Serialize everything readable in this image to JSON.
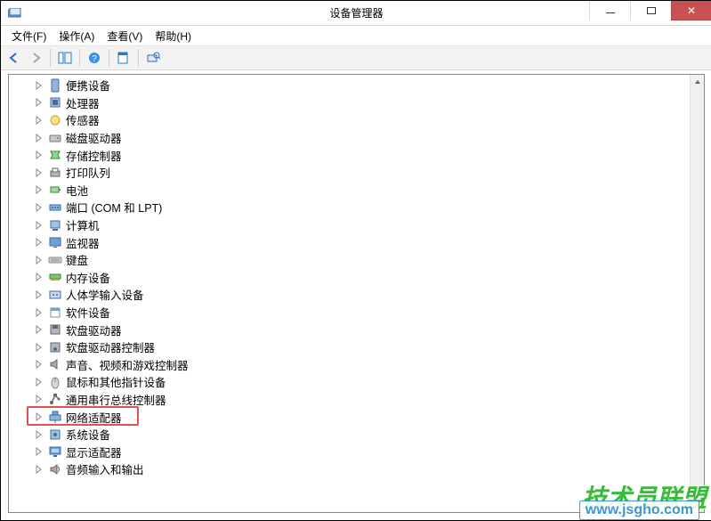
{
  "window": {
    "title": "设备管理器"
  },
  "menu": {
    "file": "文件(F)",
    "action": "操作(A)",
    "view": "查看(V)",
    "help": "帮助(H)"
  },
  "tree": {
    "items": [
      {
        "label": "便携设备",
        "icon": "portable"
      },
      {
        "label": "处理器",
        "icon": "cpu"
      },
      {
        "label": "传感器",
        "icon": "sensor"
      },
      {
        "label": "磁盘驱动器",
        "icon": "disk"
      },
      {
        "label": "存储控制器",
        "icon": "storage"
      },
      {
        "label": "打印队列",
        "icon": "printer"
      },
      {
        "label": "电池",
        "icon": "battery"
      },
      {
        "label": "端口 (COM 和 LPT)",
        "icon": "port"
      },
      {
        "label": "计算机",
        "icon": "computer"
      },
      {
        "label": "监视器",
        "icon": "monitor"
      },
      {
        "label": "键盘",
        "icon": "keyboard"
      },
      {
        "label": "内存设备",
        "icon": "memory"
      },
      {
        "label": "人体学输入设备",
        "icon": "hid"
      },
      {
        "label": "软件设备",
        "icon": "software"
      },
      {
        "label": "软盘驱动器",
        "icon": "floppy"
      },
      {
        "label": "软盘驱动器控制器",
        "icon": "floppyctrl"
      },
      {
        "label": "声音、视频和游戏控制器",
        "icon": "sound"
      },
      {
        "label": "鼠标和其他指针设备",
        "icon": "mouse"
      },
      {
        "label": "通用串行总线控制器",
        "icon": "usb"
      },
      {
        "label": "网络适配器",
        "icon": "network",
        "highlighted": true
      },
      {
        "label": "系统设备",
        "icon": "system"
      },
      {
        "label": "显示适配器",
        "icon": "display"
      },
      {
        "label": "音频输入和输出",
        "icon": "audio"
      }
    ]
  },
  "watermark": {
    "text1": "技术员联盟",
    "text2": "www.jsgho.com"
  }
}
